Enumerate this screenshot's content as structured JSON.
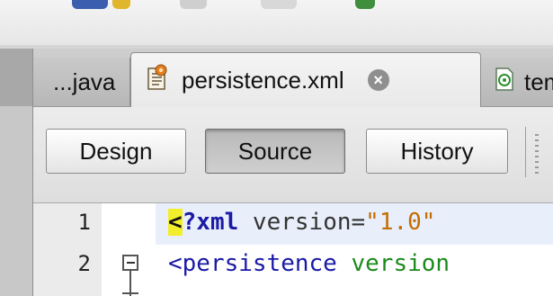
{
  "colors": {
    "tab_active_bg": "#f0f0f0",
    "tab_inactive_bg": "#c2c2c2",
    "current_line": "#e9effa",
    "match_highlight": "#f2ee2c",
    "xml_tag": "#1a1aa6",
    "xml_string": "#c46c00",
    "xml_attr": "#1d8a1d"
  },
  "tabs": [
    {
      "label": "...java",
      "icon": null,
      "active": false
    },
    {
      "label": "persistence.xml",
      "icon": "xml-config-icon",
      "active": true,
      "closable": true
    },
    {
      "label": "tem",
      "icon": "java-file-icon",
      "active": false
    }
  ],
  "editor_toolbar": {
    "design_label": "Design",
    "source_label": "Source",
    "history_label": "History",
    "selected": "Source"
  },
  "code": {
    "lines": [
      {
        "number": "1",
        "tokens": [
          "<",
          "?xml",
          " version=",
          "\"1.0\""
        ]
      },
      {
        "number": "2",
        "tokens": [
          "<persistence",
          " version"
        ]
      }
    ]
  },
  "icons": {
    "close": "×"
  }
}
